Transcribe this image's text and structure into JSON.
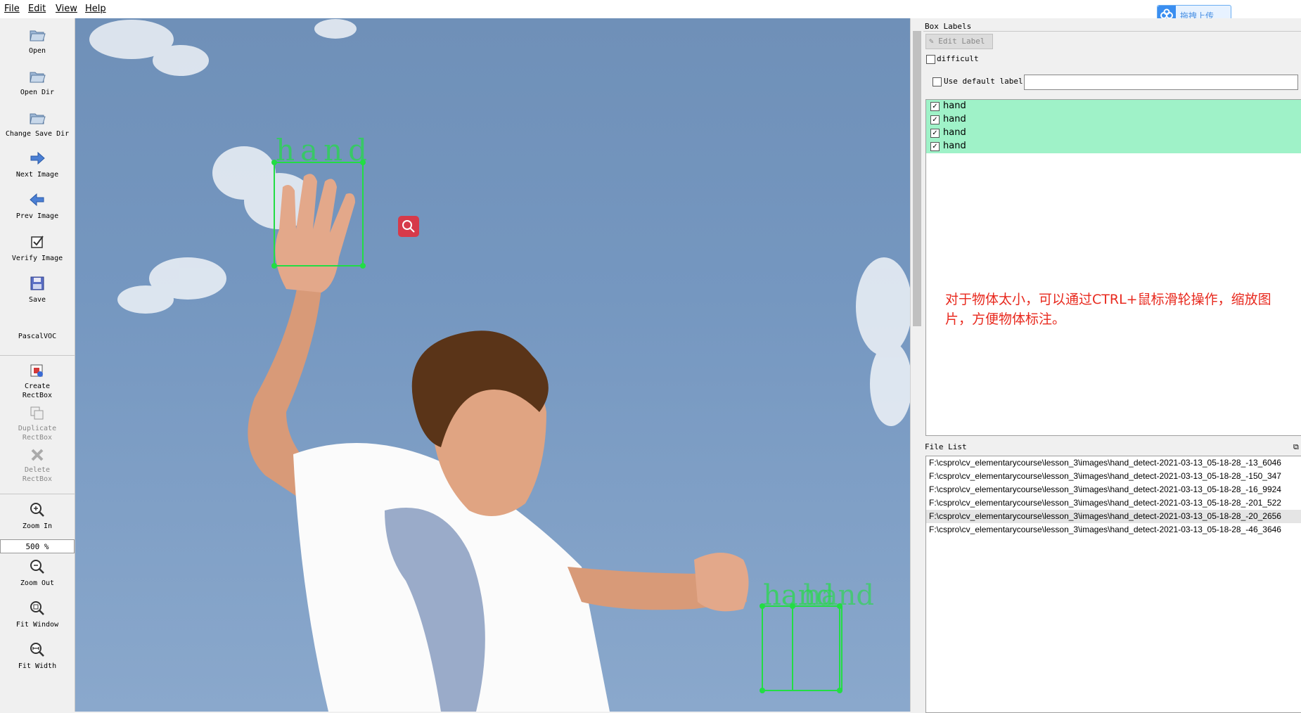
{
  "menu": {
    "items": [
      "File",
      "Edit",
      "View",
      "Help"
    ]
  },
  "upload_button": {
    "label": "拖拽上传"
  },
  "toolbar": {
    "open": "Open",
    "open_dir": "Open Dir",
    "change_save_dir": "Change Save Dir",
    "next_image": "Next Image",
    "prev_image": "Prev Image",
    "verify_image": "Verify Image",
    "save": "Save",
    "format": "PascalVOC",
    "create_rectbox": "Create\nRectBox",
    "duplicate_rectbox": "Duplicate\nRectBox",
    "delete_rectbox": "Delete\nRectBox",
    "zoom_in": "Zoom In",
    "zoom_value": "500 %",
    "zoom_out": "Zoom Out",
    "fit_window": "Fit Window",
    "fit_width": "Fit Width"
  },
  "canvas": {
    "box_labels": [
      "hand",
      "hand",
      "hand",
      "hand"
    ]
  },
  "box_labels_panel": {
    "title": "Box Labels",
    "edit_label_button": "Edit Label",
    "difficult_label": "difficult",
    "difficult_checked": false,
    "use_default_label": "Use default label",
    "use_default_checked": false,
    "default_label_value": "",
    "labels": [
      {
        "text": "hand",
        "checked": true
      },
      {
        "text": "hand",
        "checked": true
      },
      {
        "text": "hand",
        "checked": true
      },
      {
        "text": "hand",
        "checked": true
      }
    ],
    "annotation": "对于物体太小，可以通过CTRL+鼠标滑轮操作，缩放图片，方便物体标注。"
  },
  "file_list_panel": {
    "title": "File List",
    "files": [
      "F:\\cspro\\cv_elementarycourse\\lesson_3\\images\\hand_detect-2021-03-13_05-18-28_-13_6046",
      "F:\\cspro\\cv_elementarycourse\\lesson_3\\images\\hand_detect-2021-03-13_05-18-28_-150_347",
      "F:\\cspro\\cv_elementarycourse\\lesson_3\\images\\hand_detect-2021-03-13_05-18-28_-16_9924",
      "F:\\cspro\\cv_elementarycourse\\lesson_3\\images\\hand_detect-2021-03-13_05-18-28_-201_522",
      "F:\\cspro\\cv_elementarycourse\\lesson_3\\images\\hand_detect-2021-03-13_05-18-28_-20_2656",
      "F:\\cspro\\cv_elementarycourse\\lesson_3\\images\\hand_detect-2021-03-13_05-18-28_-46_3646"
    ],
    "selected_index": 4
  },
  "colors": {
    "box_green": "#22dd44",
    "label_row_bg": "#9ff2c8",
    "annotation_red": "#e8291e"
  }
}
